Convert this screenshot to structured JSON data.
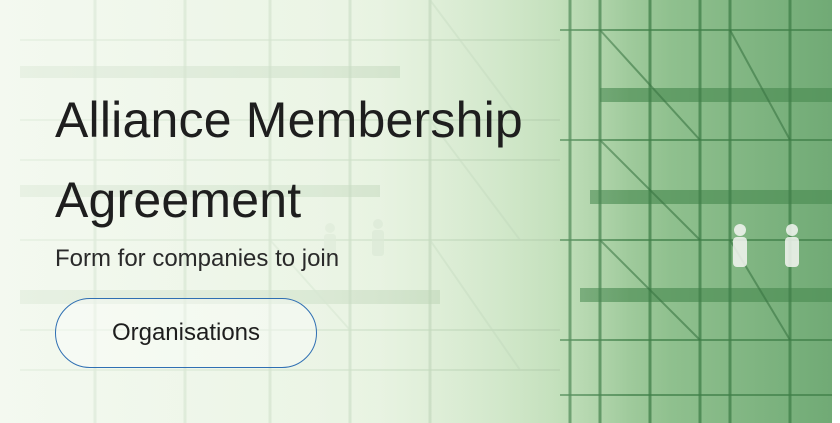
{
  "hero": {
    "title": "Alliance Membership Agreement",
    "subtitle": "Form for companies to join",
    "button_label": "Organisations",
    "background_icon": "scaffolding-photo",
    "colors": {
      "text": "#1e1e1e",
      "button_border": "#2f6fb3",
      "tint_light": "#eef4e9",
      "tint_dark": "#5d9a63"
    }
  }
}
